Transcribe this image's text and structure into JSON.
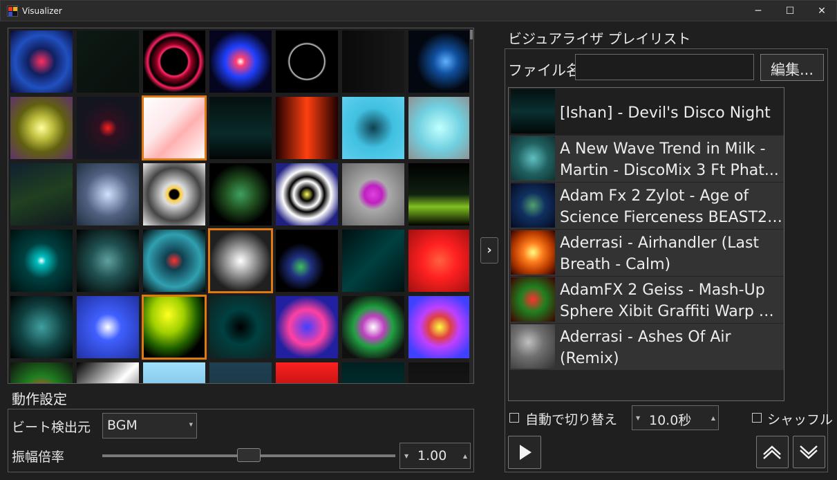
{
  "window": {
    "title": "Visualizer",
    "minimize_glyph": "─",
    "maximize_glyph": "☐",
    "close_glyph": "✕"
  },
  "grid": {
    "selected_tiles": [
      9,
      24,
      30
    ]
  },
  "settings": {
    "heading": "動作設定",
    "beat_source_label": "ビート検出元",
    "beat_source_value": "BGM",
    "amplitude_label": "振幅倍率",
    "amplitude_value": "1.00",
    "amplitude_level": 0.5
  },
  "expand_button": "›",
  "playlist_panel": {
    "heading": "ビジュアライザ プレイリスト",
    "file_name_label": "ファイル名",
    "file_name_value": "",
    "edit_button": "編集...",
    "items": [
      {
        "line1": "[Ishan] - Devil's Disco Night",
        "line2": ""
      },
      {
        "line1": "A New Wave Trend in Milk -",
        "line2": "Martin - DiscoMix  3 Ft Phat..."
      },
      {
        "line1": "Adam Fx 2 Zylot - Age of",
        "line2": "Science Fierceness BEAST2 -..."
      },
      {
        "line1": "Aderrasi - Airhandler (Last",
        "line2": "Breath - Calm)"
      },
      {
        "line1": "AdamFX 2 Geiss - Mash-Up",
        "line2": "Sphere Xibit Graffiti Warp m..."
      },
      {
        "line1": "Aderrasi - Ashes Of Air",
        "line2": "(Remix)"
      }
    ],
    "auto_switch_label": "自動で切り替え",
    "auto_switch_checked": false,
    "interval_value": "10.0秒",
    "shuffle_label": "シャッフル",
    "shuffle_checked": false
  },
  "colors": {
    "background": "#1f1f1f",
    "selection_outline": "#e07a10",
    "alt_row": "#333333"
  }
}
